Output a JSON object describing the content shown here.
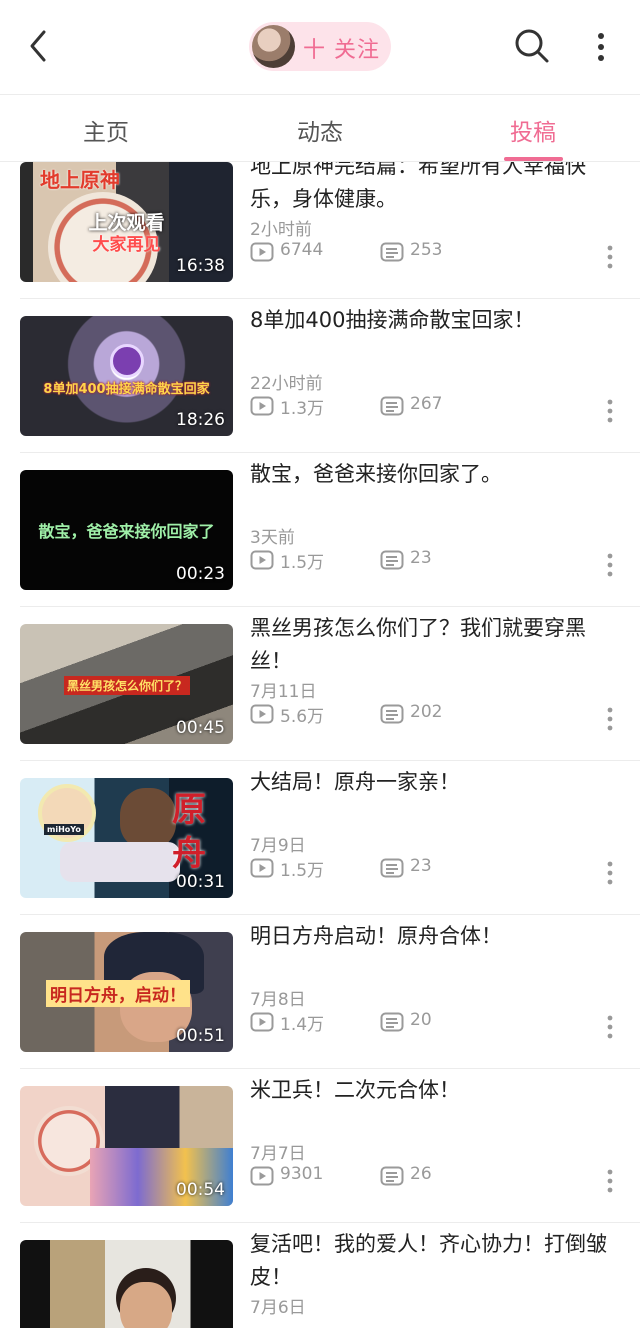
{
  "header": {
    "follow_label": "十 关注",
    "icons": {
      "back": "chevron-left-icon",
      "search": "search-icon",
      "more": "more-vertical-icon"
    },
    "accent": "#f06c93"
  },
  "tabs": [
    {
      "label": "主页",
      "active": false
    },
    {
      "label": "动态",
      "active": false
    },
    {
      "label": "投稿",
      "active": true
    }
  ],
  "videos": [
    {
      "title": "地上原神完结篇：希望所有人幸福快乐，身体健康。",
      "date": "2小时前",
      "views": "6744",
      "comments": "253",
      "duration": "16:38",
      "thumb_text": [
        "地上原神",
        "上次观看",
        "大家再见"
      ]
    },
    {
      "title": "8单加400抽接满命散宝回家！",
      "date": "22小时前",
      "views": "1.3万",
      "comments": "267",
      "duration": "18:26",
      "thumb_text": [
        "8单加400抽接满命散宝回家"
      ]
    },
    {
      "title": "散宝，爸爸来接你回家了。",
      "date": "3天前",
      "views": "1.5万",
      "comments": "23",
      "duration": "00:23",
      "thumb_text": [
        "散宝，爸爸来接你回家了"
      ]
    },
    {
      "title": "黑丝男孩怎么你们了？我们就要穿黑丝！",
      "date": "7月11日",
      "views": "5.6万",
      "comments": "202",
      "duration": "00:45",
      "thumb_text": [
        "黑丝男孩怎么你们了？"
      ]
    },
    {
      "title": "大结局！原舟一家亲！",
      "date": "7月9日",
      "views": "1.5万",
      "comments": "23",
      "duration": "00:31",
      "thumb_text": [
        "原",
        "舟",
        "miHoYo"
      ]
    },
    {
      "title": "明日方舟启动！原舟合体！",
      "date": "7月8日",
      "views": "1.4万",
      "comments": "20",
      "duration": "00:51",
      "thumb_text": [
        "明日方舟，启动！"
      ]
    },
    {
      "title": "米卫兵！二次元合体！",
      "date": "7月7日",
      "views": "9301",
      "comments": "26",
      "duration": "00:54",
      "thumb_text": []
    },
    {
      "title": "复活吧！我的爱人！齐心协力！打倒皱皮！",
      "date": "7月6日",
      "views": "",
      "comments": "",
      "duration": "",
      "thumb_text": []
    }
  ]
}
